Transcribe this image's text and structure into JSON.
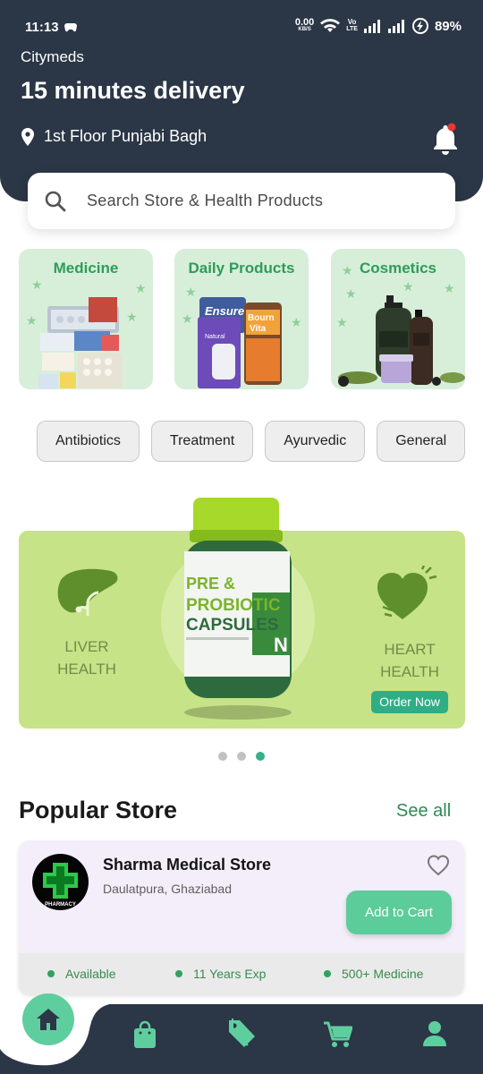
{
  "status_bar": {
    "time": "11:13",
    "net_speed_value": "0.00",
    "net_speed_unit": "KB/S",
    "volte_1": "Vo",
    "volte_2": "LTE",
    "battery": "89%"
  },
  "header": {
    "brand": "Citymeds",
    "headline": "15 minutes delivery",
    "location": "1st Floor Punjabi Bagh"
  },
  "search": {
    "placeholder": "Search Store & Health Products"
  },
  "categories": [
    {
      "title": "Medicine"
    },
    {
      "title": "Daily Products"
    },
    {
      "title": "Cosmetics"
    }
  ],
  "chips": [
    "Antibiotics",
    "Treatment",
    "Ayurvedic",
    "General"
  ],
  "banner": {
    "left_text_1": "LIVER",
    "left_text_2": "HEALTH",
    "right_text_1": "HEART",
    "right_text_2": "HEALTH",
    "bottle_line_1": "PRE &",
    "bottle_line_2": "PROBIOTIC",
    "bottle_line_3": "CAPSULES",
    "cta": "Order Now",
    "dots_count": 3,
    "active_dot": 3
  },
  "category_art": {
    "daily_brand_1": "Ensure",
    "daily_brand_2": "Bourn Vita",
    "daily_item": "Natural"
  },
  "popular": {
    "title": "Popular Store",
    "see_all": "See all"
  },
  "store": {
    "name": "Sharma Medical Store",
    "location": "Daulatpura, Ghaziabad",
    "logo_text": "PHARMACY",
    "add_to_cart": "Add to Cart",
    "features": [
      "Available",
      "11 Years Exp",
      "500+ Medicine"
    ]
  },
  "colors": {
    "header_bg": "#2b3646",
    "accent_green": "#5ccc9a",
    "category_bg": "#d7efd9",
    "banner_bg": "#c6e387"
  },
  "bottom_nav": {
    "items": [
      "home-icon",
      "shopping-bag-icon",
      "tag-icon",
      "cart-icon",
      "profile-icon"
    ]
  }
}
